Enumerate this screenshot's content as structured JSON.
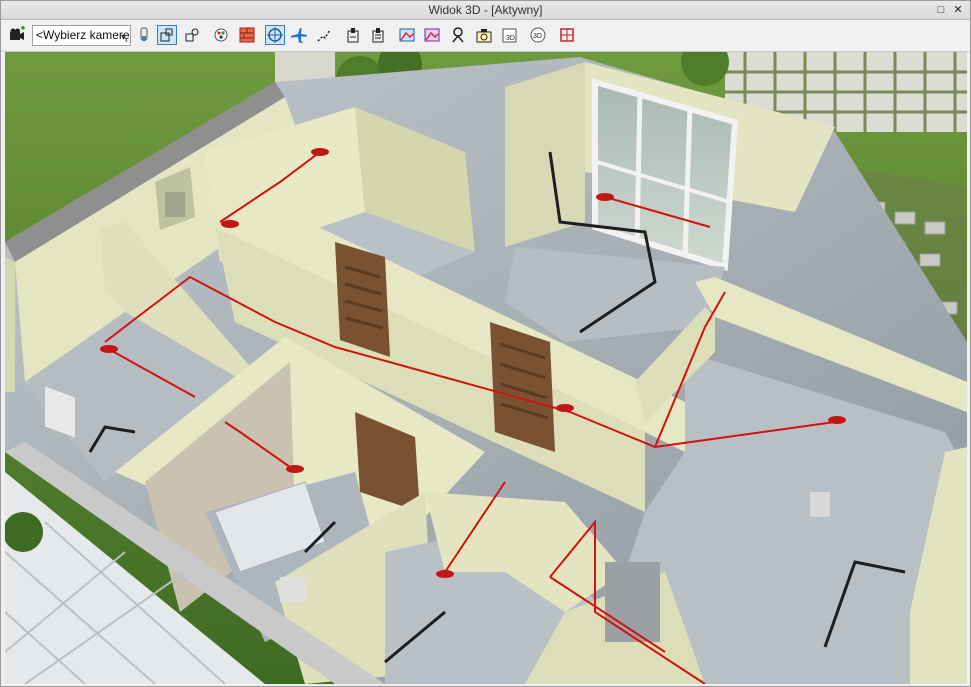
{
  "window": {
    "title": "Widok 3D - [Aktywny]",
    "restore_glyph": "□",
    "close_glyph": "✕"
  },
  "toolbar": {
    "camera_select": {
      "value": "<Wybierz kamerę>"
    },
    "tools": [
      {
        "name": "add-camera-icon",
        "active": false
      },
      {
        "name": "camera-light-icon",
        "active": false
      },
      {
        "name": "view-mode-1-icon",
        "active": true
      },
      {
        "name": "view-mode-2-icon",
        "active": false
      },
      {
        "name": "color-palette-icon",
        "active": false
      },
      {
        "name": "walls-icon",
        "active": false
      },
      {
        "name": "orbit-icon",
        "active": true
      },
      {
        "name": "fly-icon",
        "active": false
      },
      {
        "name": "path-icon",
        "active": false
      },
      {
        "name": "section-1-icon",
        "active": false
      },
      {
        "name": "section-2-icon",
        "active": false
      },
      {
        "name": "render-1-icon",
        "active": false
      },
      {
        "name": "render-2-icon",
        "active": false
      },
      {
        "name": "camera-view-icon",
        "active": false
      },
      {
        "name": "screenshot-icon",
        "active": false
      },
      {
        "name": "export-3d-icon",
        "active": false
      },
      {
        "name": "rotate-3d-icon",
        "active": false
      },
      {
        "name": "frame-icon",
        "active": false
      }
    ],
    "labels": {
      "export_3d": "3D",
      "rotate_3d": "3D"
    }
  },
  "colors": {
    "accent": "#3c7fb1",
    "wall": "#e7e8c4",
    "wall_shade": "#c9cba2",
    "floor": "#aeb6bd",
    "grass": "#4e7a2b",
    "pipe": "#d41010",
    "cable": "#1e1e1e",
    "door": "#7a5232"
  }
}
